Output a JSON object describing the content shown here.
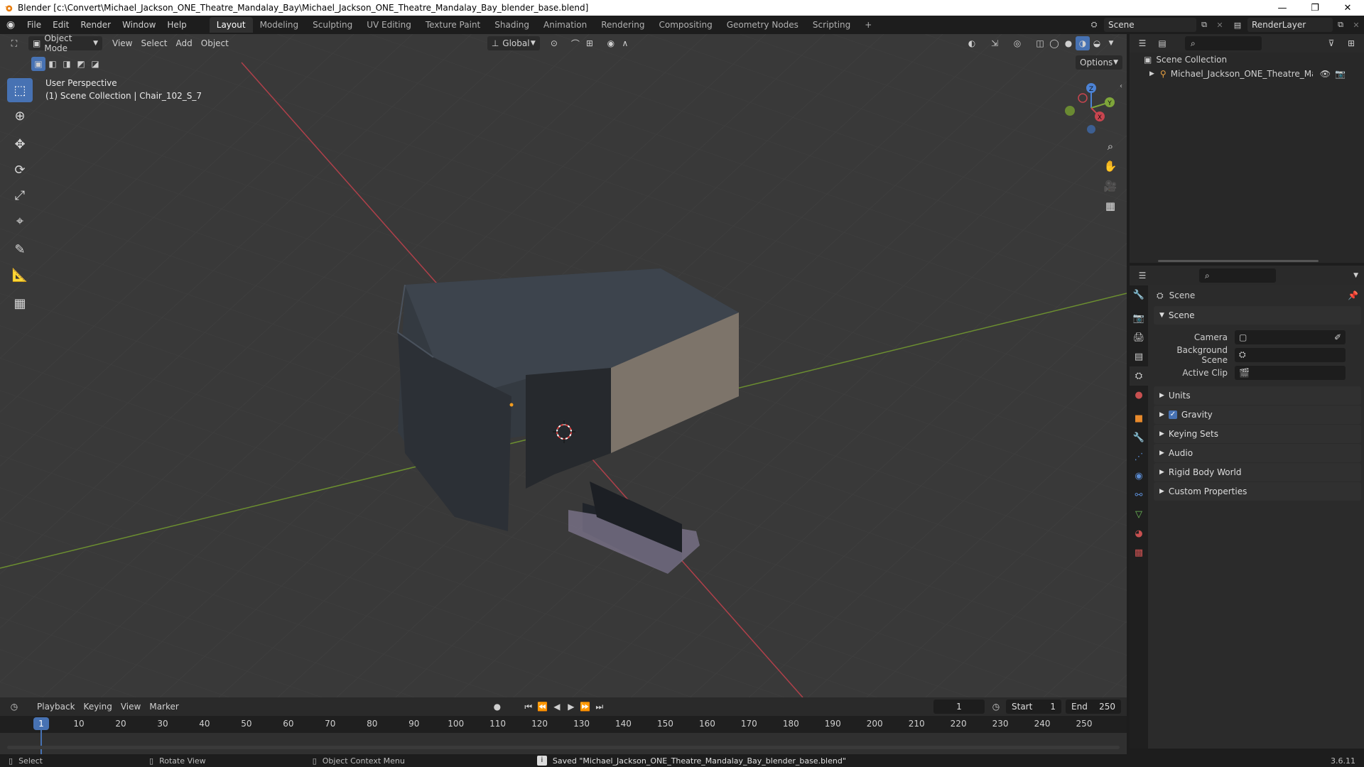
{
  "titlebar": {
    "title": "Blender [c:\\Convert\\Michael_Jackson_ONE_Theatre_Mandalay_Bay\\Michael_Jackson_ONE_Theatre_Mandalay_Bay_blender_base.blend]",
    "minimize": "—",
    "maximize": "❐",
    "close": "✕"
  },
  "menu": {
    "items": [
      "File",
      "Edit",
      "Render",
      "Window",
      "Help"
    ],
    "workspaces": [
      "Layout",
      "Modeling",
      "Sculpting",
      "UV Editing",
      "Texture Paint",
      "Shading",
      "Animation",
      "Rendering",
      "Compositing",
      "Geometry Nodes",
      "Scripting"
    ],
    "active_workspace": "Layout",
    "add_workspace": "+",
    "scene_name": "Scene",
    "view_layer": "RenderLayer"
  },
  "viewport": {
    "mode": "Object Mode",
    "menus": [
      "View",
      "Select",
      "Add",
      "Object"
    ],
    "orientation": "Global",
    "options": "Options",
    "perspective": "User Perspective",
    "collection_info": "(1) Scene Collection | Chair_102_S_7",
    "gizmo_axes": {
      "x": "X",
      "y": "Y",
      "z": "Z"
    }
  },
  "outliner": {
    "root": "Scene Collection",
    "object": "Michael_Jackson_ONE_Theatre_Mandalz"
  },
  "properties": {
    "context": "Scene",
    "section": "Scene",
    "fields": [
      {
        "label": "Camera",
        "value": ""
      },
      {
        "label": "Background Scene",
        "value": ""
      },
      {
        "label": "Active Clip",
        "value": ""
      }
    ],
    "panels": [
      "Units",
      "Gravity",
      "Keying Sets",
      "Audio",
      "Rigid Body World",
      "Custom Properties"
    ],
    "gravity_enabled": true
  },
  "timeline": {
    "menus": [
      "Playback",
      "Keying",
      "View",
      "Marker"
    ],
    "current_frame": "1",
    "start_label": "Start",
    "start": "1",
    "end_label": "End",
    "end": "250",
    "ticks": [
      "1",
      "10",
      "20",
      "30",
      "40",
      "50",
      "60",
      "70",
      "80",
      "90",
      "100",
      "110",
      "120",
      "130",
      "140",
      "150",
      "160",
      "170",
      "180",
      "190",
      "200",
      "210",
      "220",
      "230",
      "240",
      "250"
    ]
  },
  "status": {
    "select": "Select",
    "rotate": "Rotate View",
    "context_menu": "Object Context Menu",
    "message": "Saved \"Michael_Jackson_ONE_Theatre_Mandalay_Bay_blender_base.blend\"",
    "version": "3.6.11"
  },
  "colors": {
    "accent": "#4772b3",
    "x_axis": "#c8454f",
    "y_axis": "#7ea53a",
    "z_axis": "#4c83d6"
  }
}
